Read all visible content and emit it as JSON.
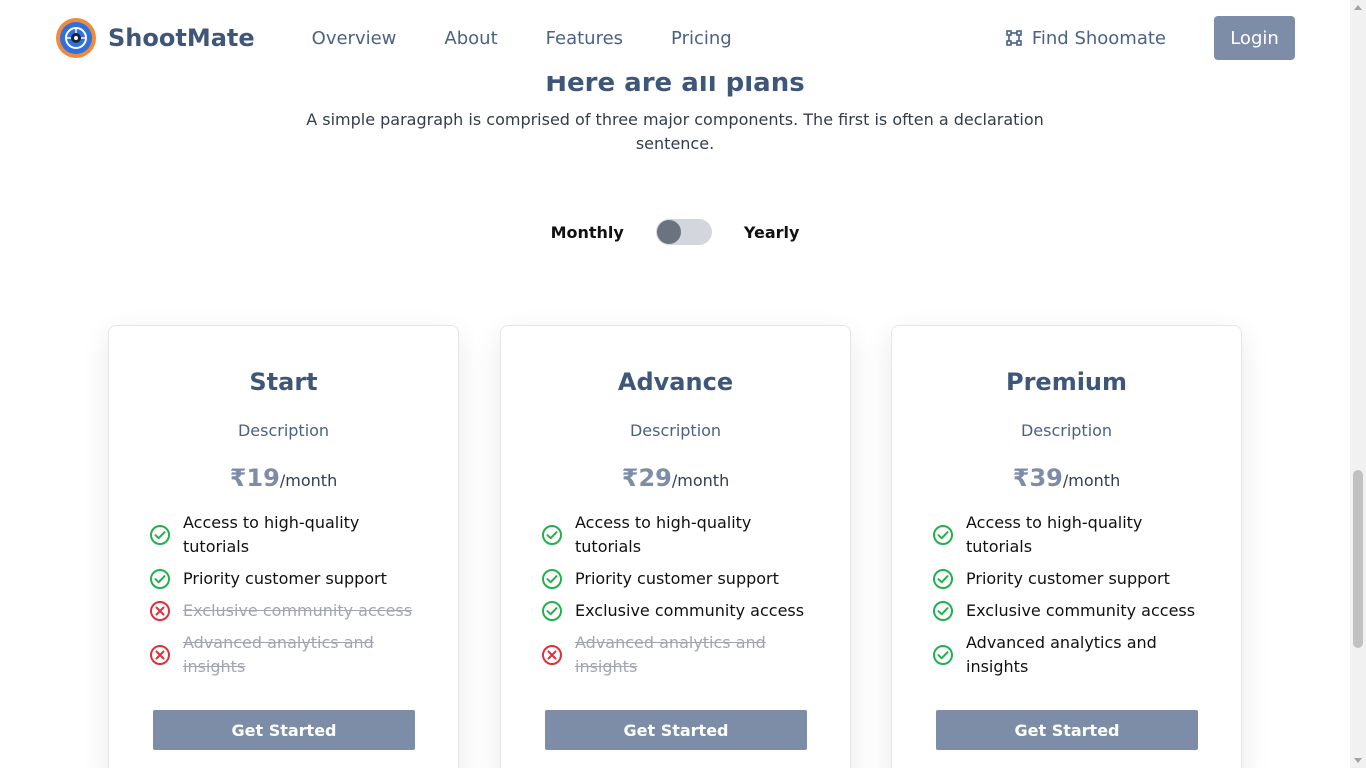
{
  "nav": {
    "brand": "ShootMate",
    "links": [
      "Overview",
      "About",
      "Features",
      "Pricing"
    ],
    "find_label": "Find Shoomate",
    "login_label": "Login"
  },
  "section": {
    "title": "Here are all plans",
    "subtitle": "A simple paragraph is comprised of three major components. The first is often a declaration sentence."
  },
  "billing_toggle": {
    "left_label": "Monthly",
    "right_label": "Yearly",
    "selected": "Monthly"
  },
  "plans": [
    {
      "name": "Start",
      "description": "Description",
      "price": "₹19",
      "period": "/month",
      "features": [
        {
          "text": "Access to high-quality tutorials",
          "included": true
        },
        {
          "text": "Priority customer support",
          "included": true
        },
        {
          "text": "Exclusive community access",
          "included": false
        },
        {
          "text": "Advanced analytics and insights",
          "included": false
        }
      ],
      "cta": "Get Started"
    },
    {
      "name": "Advance",
      "description": "Description",
      "price": "₹29",
      "period": "/month",
      "features": [
        {
          "text": "Access to high-quality tutorials",
          "included": true
        },
        {
          "text": "Priority customer support",
          "included": true
        },
        {
          "text": "Exclusive community access",
          "included": true
        },
        {
          "text": "Advanced analytics and insights",
          "included": false
        }
      ],
      "cta": "Get Started"
    },
    {
      "name": "Premium",
      "description": "Description",
      "price": "₹39",
      "period": "/month",
      "features": [
        {
          "text": "Access to high-quality tutorials",
          "included": true
        },
        {
          "text": "Priority customer support",
          "included": true
        },
        {
          "text": "Exclusive community access",
          "included": true
        },
        {
          "text": "Advanced analytics and insights",
          "included": true
        }
      ],
      "cta": "Get Started"
    }
  ],
  "icons": {
    "check": "check-circle-icon",
    "cross": "x-circle-icon",
    "find": "scan-frame-icon",
    "logo": "camera-aperture-logo"
  },
  "colors": {
    "brand": "#3e5678",
    "button": "#7d8da8",
    "check": "#22b14c",
    "cross": "#e0303a",
    "logo_ring": "#f08a3c",
    "logo_core": "#2f6fe0"
  }
}
